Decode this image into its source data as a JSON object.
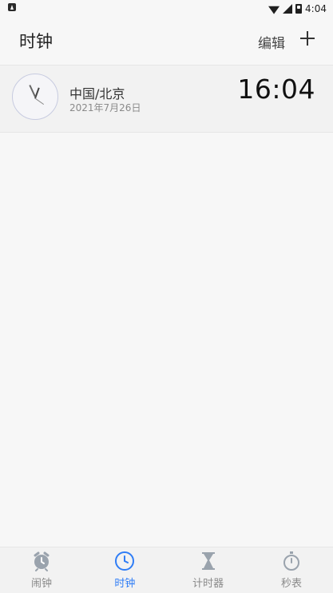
{
  "status_bar": {
    "time": "4:04"
  },
  "app_bar": {
    "title": "时钟",
    "edit_label": "编辑"
  },
  "clock_card": {
    "city": "中国/北京",
    "date": "2021年7月26日",
    "time": "16:04"
  },
  "bottom_nav": {
    "items": [
      {
        "label": "闹钟",
        "icon": "alarm-icon"
      },
      {
        "label": "时钟",
        "icon": "clock-icon"
      },
      {
        "label": "计时器",
        "icon": "hourglass-icon"
      },
      {
        "label": "秒表",
        "icon": "stopwatch-icon"
      }
    ],
    "active_index": 1
  },
  "colors": {
    "accent": "#2f7df6",
    "background": "#f7f7f7",
    "inactive": "#8a8a8a"
  }
}
